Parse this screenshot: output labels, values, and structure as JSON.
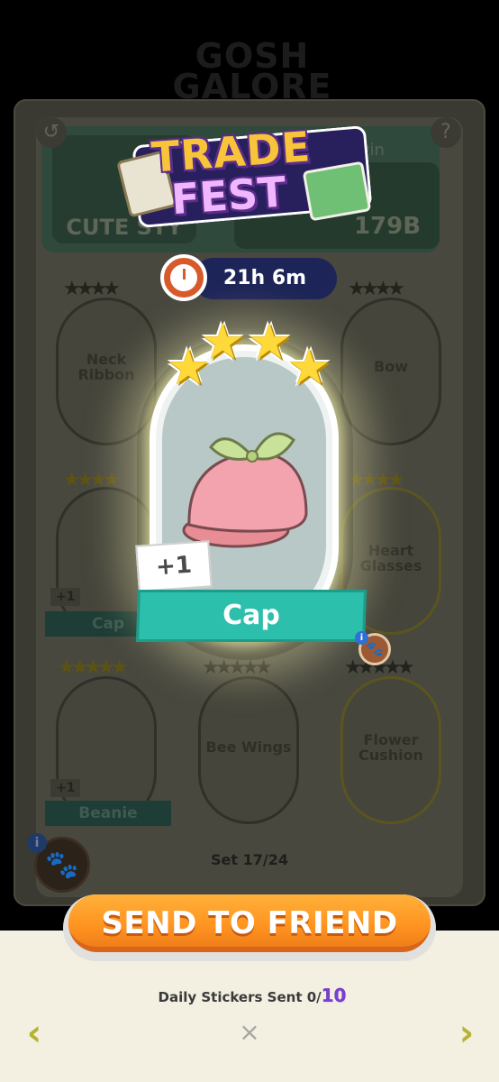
{
  "background": {
    "header_text": "GOSH\nGALORE",
    "set_name": "CUTE STY",
    "prize_hint": "to win",
    "prize_amount": "179B",
    "set_counter": "Set 17/24",
    "slots": [
      {
        "label": "Neck\nRibbon"
      },
      {
        "label": ""
      },
      {
        "label": "Bow"
      },
      {
        "label": "Cap",
        "count": "+1"
      },
      {
        "label": "Heart\nGlasses"
      },
      {
        "label": "Beanie",
        "count": "+1"
      },
      {
        "label": "Bee Wings"
      },
      {
        "label": "Flower\nCushion"
      }
    ]
  },
  "logo": {
    "line1": "TRADE",
    "line2": "FEST"
  },
  "timer": {
    "text": "21h 6m"
  },
  "sticker": {
    "name": "Cap",
    "count": "+1",
    "stars": 4,
    "colors": {
      "cap": "#f2a3ad",
      "leaf": "#c9e29a",
      "banner": "#2cbfac"
    }
  },
  "actions": {
    "send_label": "SEND TO FRIEND",
    "daily_label": "Daily Stickers Sent",
    "daily_sent": "0/",
    "daily_max": "10",
    "prev_icon": "‹",
    "next_icon": "›",
    "close_icon": "×"
  }
}
